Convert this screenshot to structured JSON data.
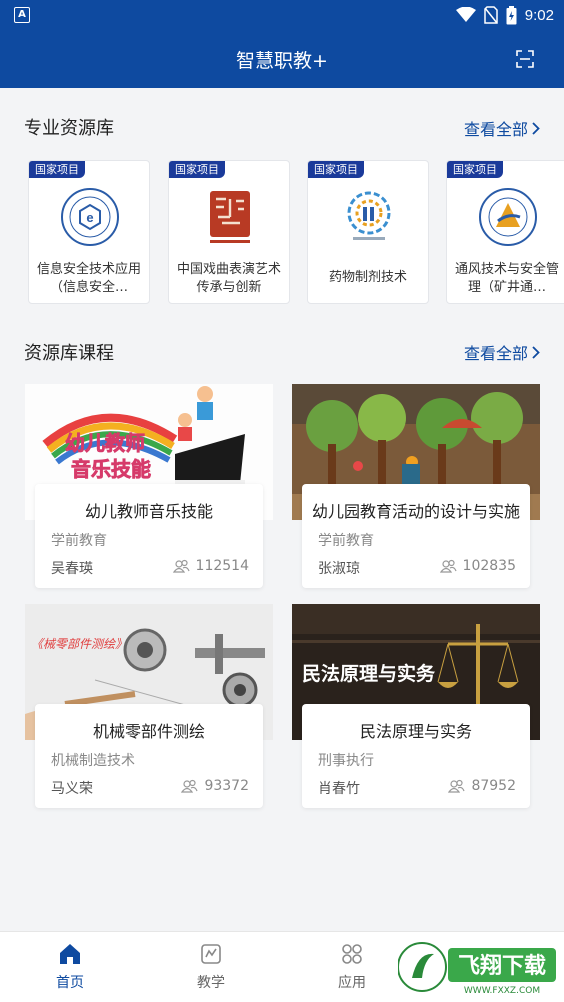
{
  "status_bar": {
    "time": "9:02",
    "app_indicator": "A"
  },
  "header": {
    "title": "智慧职教+",
    "scan_icon": "scan-icon"
  },
  "resource_section": {
    "title": "专业资源库",
    "see_all": "查看全部",
    "cards": [
      {
        "tag": "国家项目",
        "name": "信息安全技术应用（信息安全…"
      },
      {
        "tag": "国家项目",
        "name": "中国戏曲表演艺术传承与创新"
      },
      {
        "tag": "国家项目",
        "name": "药物制剂技术"
      },
      {
        "tag": "国家项目",
        "name": "通风技术与安全管理（矿井通…"
      }
    ]
  },
  "course_section": {
    "title": "资源库课程",
    "see_all": "查看全部",
    "courses": [
      {
        "title": "幼儿教师音乐技能",
        "category": "学前教育",
        "teacher": "吴春瑛",
        "count": "112514",
        "thumb_text_1": "幼儿教师",
        "thumb_text_2": "音乐技能"
      },
      {
        "title": "幼儿园教育活动的设计与实施",
        "category": "学前教育",
        "teacher": "张淑琼",
        "count": "102835"
      },
      {
        "title": "机械零部件测绘",
        "category": "机械制造技术",
        "teacher": "马义荣",
        "count": "93372",
        "thumb_text_1": "《械零部件测绘》"
      },
      {
        "title": "民法原理与实务",
        "category": "刑事执行",
        "teacher": "肖春竹",
        "count": "87952",
        "thumb_text_1": "民法原理与实务"
      }
    ]
  },
  "bottom_nav": {
    "items": [
      {
        "label": "首页",
        "active": true
      },
      {
        "label": "教学",
        "active": false
      },
      {
        "label": "应用",
        "active": false
      }
    ]
  },
  "watermark": {
    "text": "飞翔下载",
    "sub": "WWW.FXXZ.COM"
  },
  "colors": {
    "brand": "#0e4aa0",
    "tag": "#1a3a9a",
    "background": "#f3f4f6"
  }
}
